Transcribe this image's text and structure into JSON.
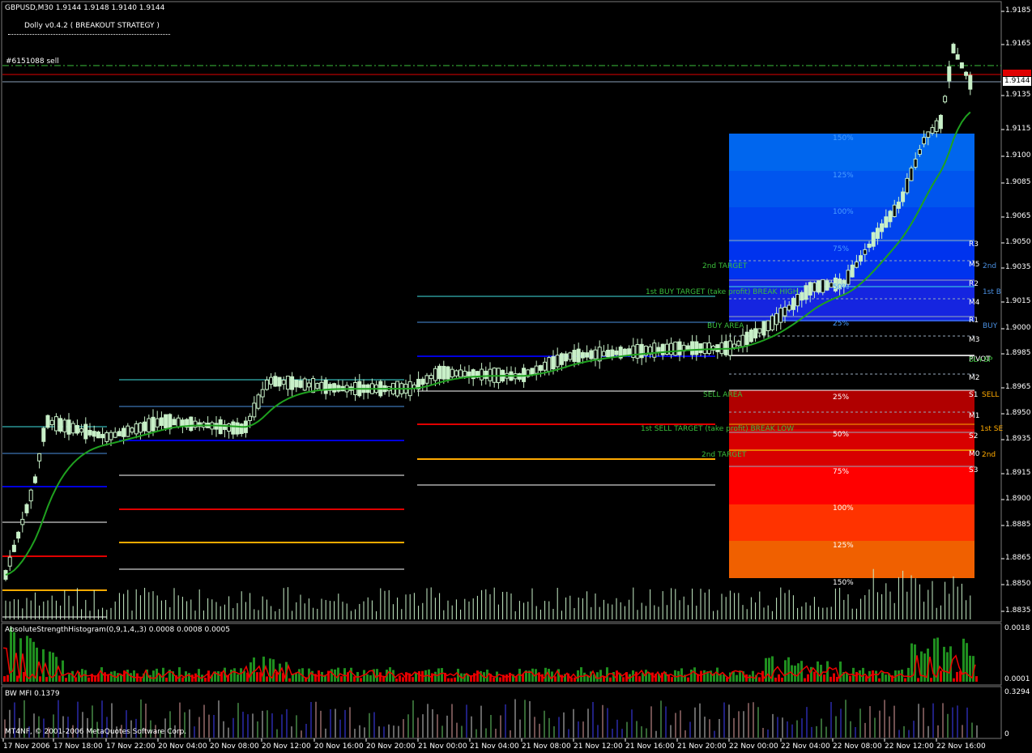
{
  "main": {
    "header": "GBPUSD,M30  1.9144 1.9148 1.9140 1.9144",
    "strategy": "Dolly v0.4.2 ( BREAKOUT STRATEGY )",
    "order_label": "#6151088 sell",
    "current_price": "1.9144",
    "price_ticks": [
      "1.9185",
      "1.9165",
      "1.9135",
      "1.9115",
      "1.9100",
      "1.9085",
      "1.9065",
      "1.9050",
      "1.9035",
      "1.9015",
      "1.9000",
      "1.8985",
      "1.8965",
      "1.8950",
      "1.8935",
      "1.8915",
      "1.8900",
      "1.8885",
      "1.8865",
      "1.8850",
      "1.8835"
    ],
    "area_labels": {
      "buy_area": "BUY AREA",
      "sell_area": "SELL AREA",
      "target2": "2nd TARGET",
      "buy1": "1st BUY TARGET (take profit) BREAK HIGH",
      "sell1": "1st SELL TARGET (take profit) BREAK LOW",
      "sell_target2": "2nd TARGET"
    },
    "fib_labels": [
      "150%",
      "125%",
      "100%",
      "75%",
      "50%",
      "25%",
      "25%",
      "50%",
      "75%",
      "100%",
      "125%",
      "150%"
    ],
    "pivot_labels": [
      "R3",
      "M5",
      "R2",
      "M4",
      "R1",
      "M3",
      "PIVOT",
      "M2",
      "S1",
      "M1",
      "S2",
      "M0",
      "S3"
    ],
    "side_labels": {
      "buy": "BUY",
      "first_b": "1st B",
      "second": "2nd",
      "sl": "SL+SP",
      "sell": "SELL",
      "first_s": "1st SE",
      "second_s": "2nd"
    }
  },
  "indicator1": {
    "label": "AbsoluteStrengthHistogram(0,9,1,4,,3) 0.0008 0.0008 0.0005",
    "ticks": [
      "0.0018",
      "0.0001"
    ]
  },
  "indicator2": {
    "label": "BW MFI 0.1379",
    "ticks": [
      "0.3294",
      "0"
    ]
  },
  "copyright": "MT4NF, © 2001-2006 MetaQuotes Software Corp.",
  "time_labels": [
    "17 Nov 2006",
    "17 Nov 18:00",
    "17 Nov 22:00",
    "20 Nov 04:00",
    "20 Nov 08:00",
    "20 Nov 12:00",
    "20 Nov 16:00",
    "20 Nov 20:00",
    "21 Nov 00:00",
    "21 Nov 04:00",
    "21 Nov 08:00",
    "21 Nov 12:00",
    "21 Nov 16:00",
    "21 Nov 20:00",
    "22 Nov 00:00",
    "22 Nov 04:00",
    "22 Nov 08:00",
    "22 Nov 12:00",
    "22 Nov 16:00"
  ],
  "colors": {
    "bull": "#c8f0c8",
    "ma": "#1fa11f",
    "hist_green": "#1f8f1f",
    "hist_red": "#e00000",
    "grid": "#404040"
  }
}
